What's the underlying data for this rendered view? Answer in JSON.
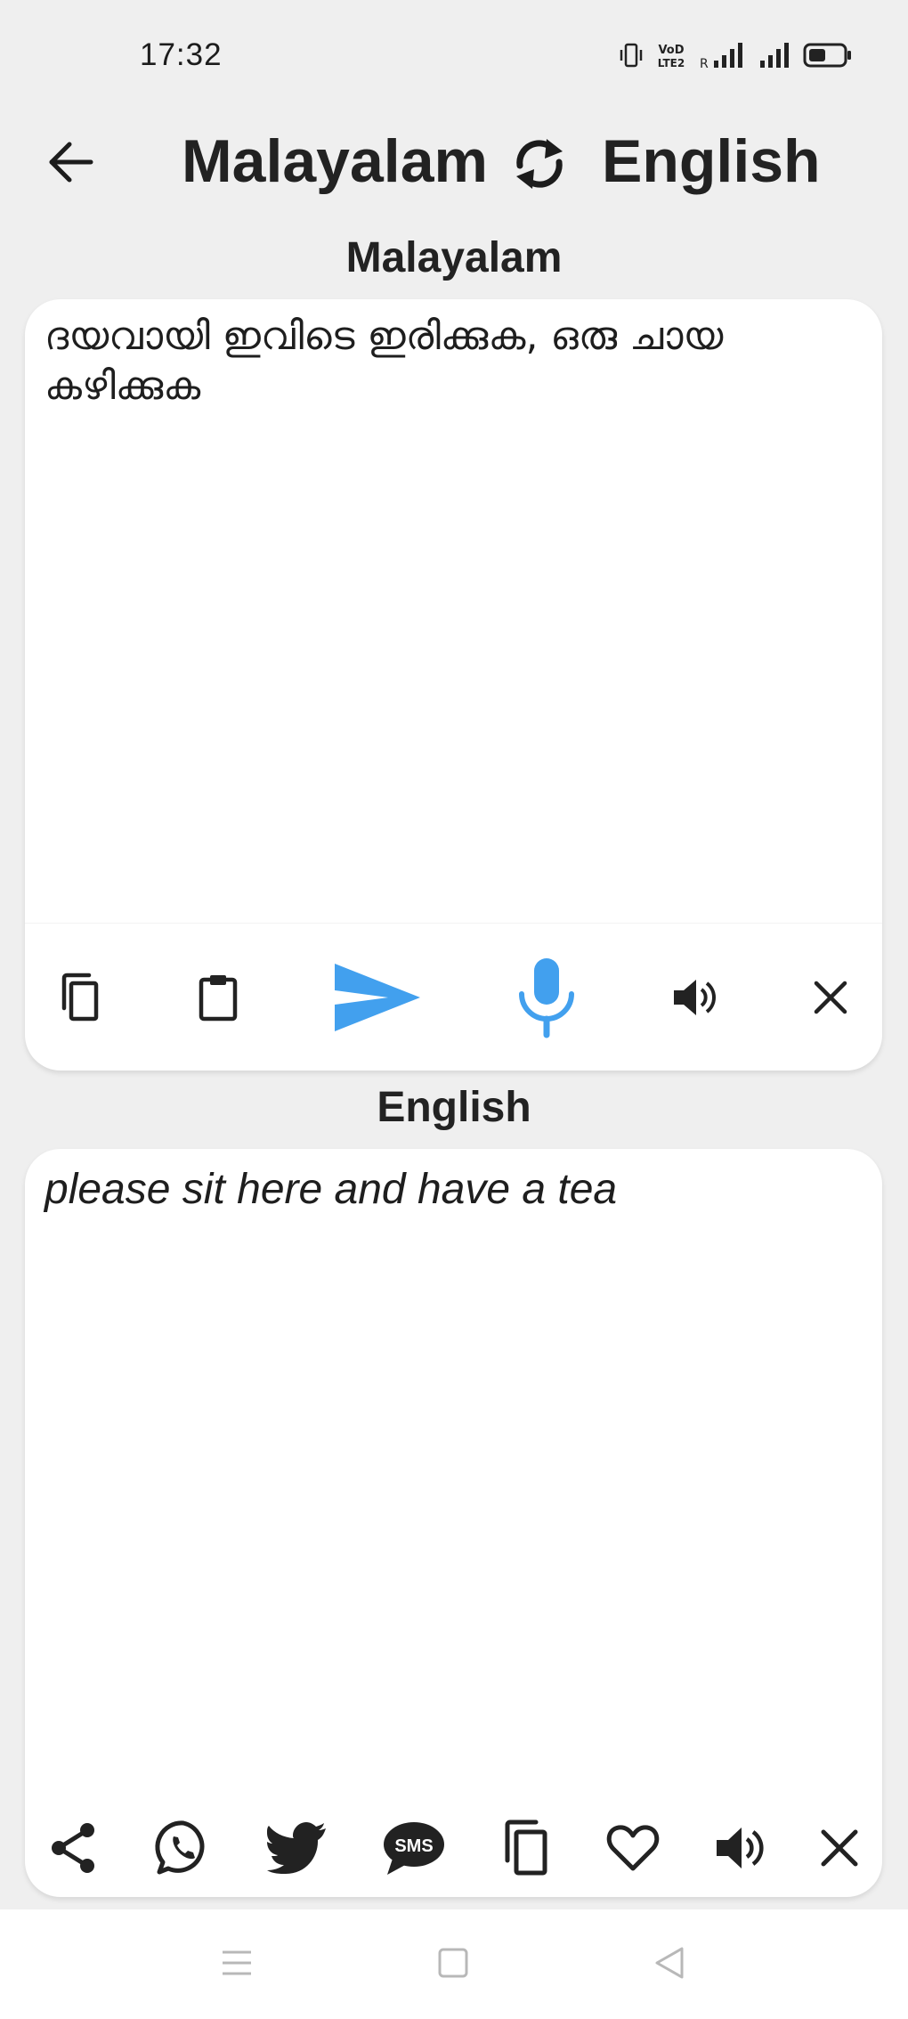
{
  "status_bar": {
    "time": "17:32",
    "icons": [
      "vibrate-icon",
      "volte-icon",
      "signal-roaming-icon",
      "signal-icon",
      "battery-icon"
    ]
  },
  "header": {
    "back_icon": "arrow-left-icon",
    "source_language": "Malayalam",
    "swap_icon": "swap-icon",
    "target_language": "English"
  },
  "source": {
    "label": "Malayalam",
    "text": "ദയവായി ഇവിടെ ഇരിക്കുക, ഒരു ചായ കഴിക്കുക",
    "toolbar": [
      "copy-icon",
      "paste-icon",
      "send-icon",
      "mic-icon",
      "speaker-icon",
      "clear-icon"
    ]
  },
  "target": {
    "label": "English",
    "text": "please sit here and have a tea",
    "toolbar": [
      "share-icon",
      "whatsapp-icon",
      "twitter-icon",
      "sms-icon",
      "copy-icon",
      "favorite-icon",
      "speaker-icon",
      "clear-icon"
    ]
  },
  "sms_badge_text": "SMS",
  "status_volte_text": "VoD LTE2",
  "status_roaming_text": "R",
  "colors": {
    "accent": "#42a0ee",
    "background": "#efefef",
    "card": "#ffffff",
    "text": "#222222"
  },
  "nav_bar": [
    "menu-icon",
    "home-icon",
    "back-triangle-icon"
  ]
}
